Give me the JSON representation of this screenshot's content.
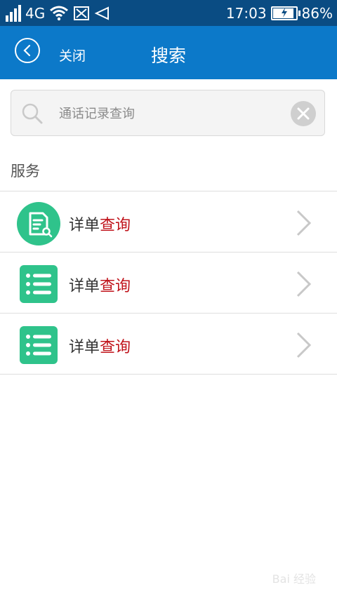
{
  "status_bar": {
    "network": "4G",
    "time": "17:03",
    "battery_percent": "86%",
    "battery_level": 0.86
  },
  "header": {
    "close_label": "关闭",
    "title": "搜索"
  },
  "search": {
    "placeholder": "通话记录查询"
  },
  "section": {
    "title": "服务"
  },
  "services": [
    {
      "label_plain": "详单",
      "label_highlight": "查询",
      "icon": "document-search-icon"
    },
    {
      "label_plain": "详单",
      "label_highlight": "查询",
      "icon": "list-icon"
    },
    {
      "label_plain": "详单",
      "label_highlight": "查询",
      "icon": "list-icon"
    }
  ],
  "colors": {
    "status_bar": "#0a4c83",
    "header": "#0c79c9",
    "icon_green": "#2fc38b",
    "highlight_red": "#c0131b"
  },
  "watermark": "Bai 经验"
}
